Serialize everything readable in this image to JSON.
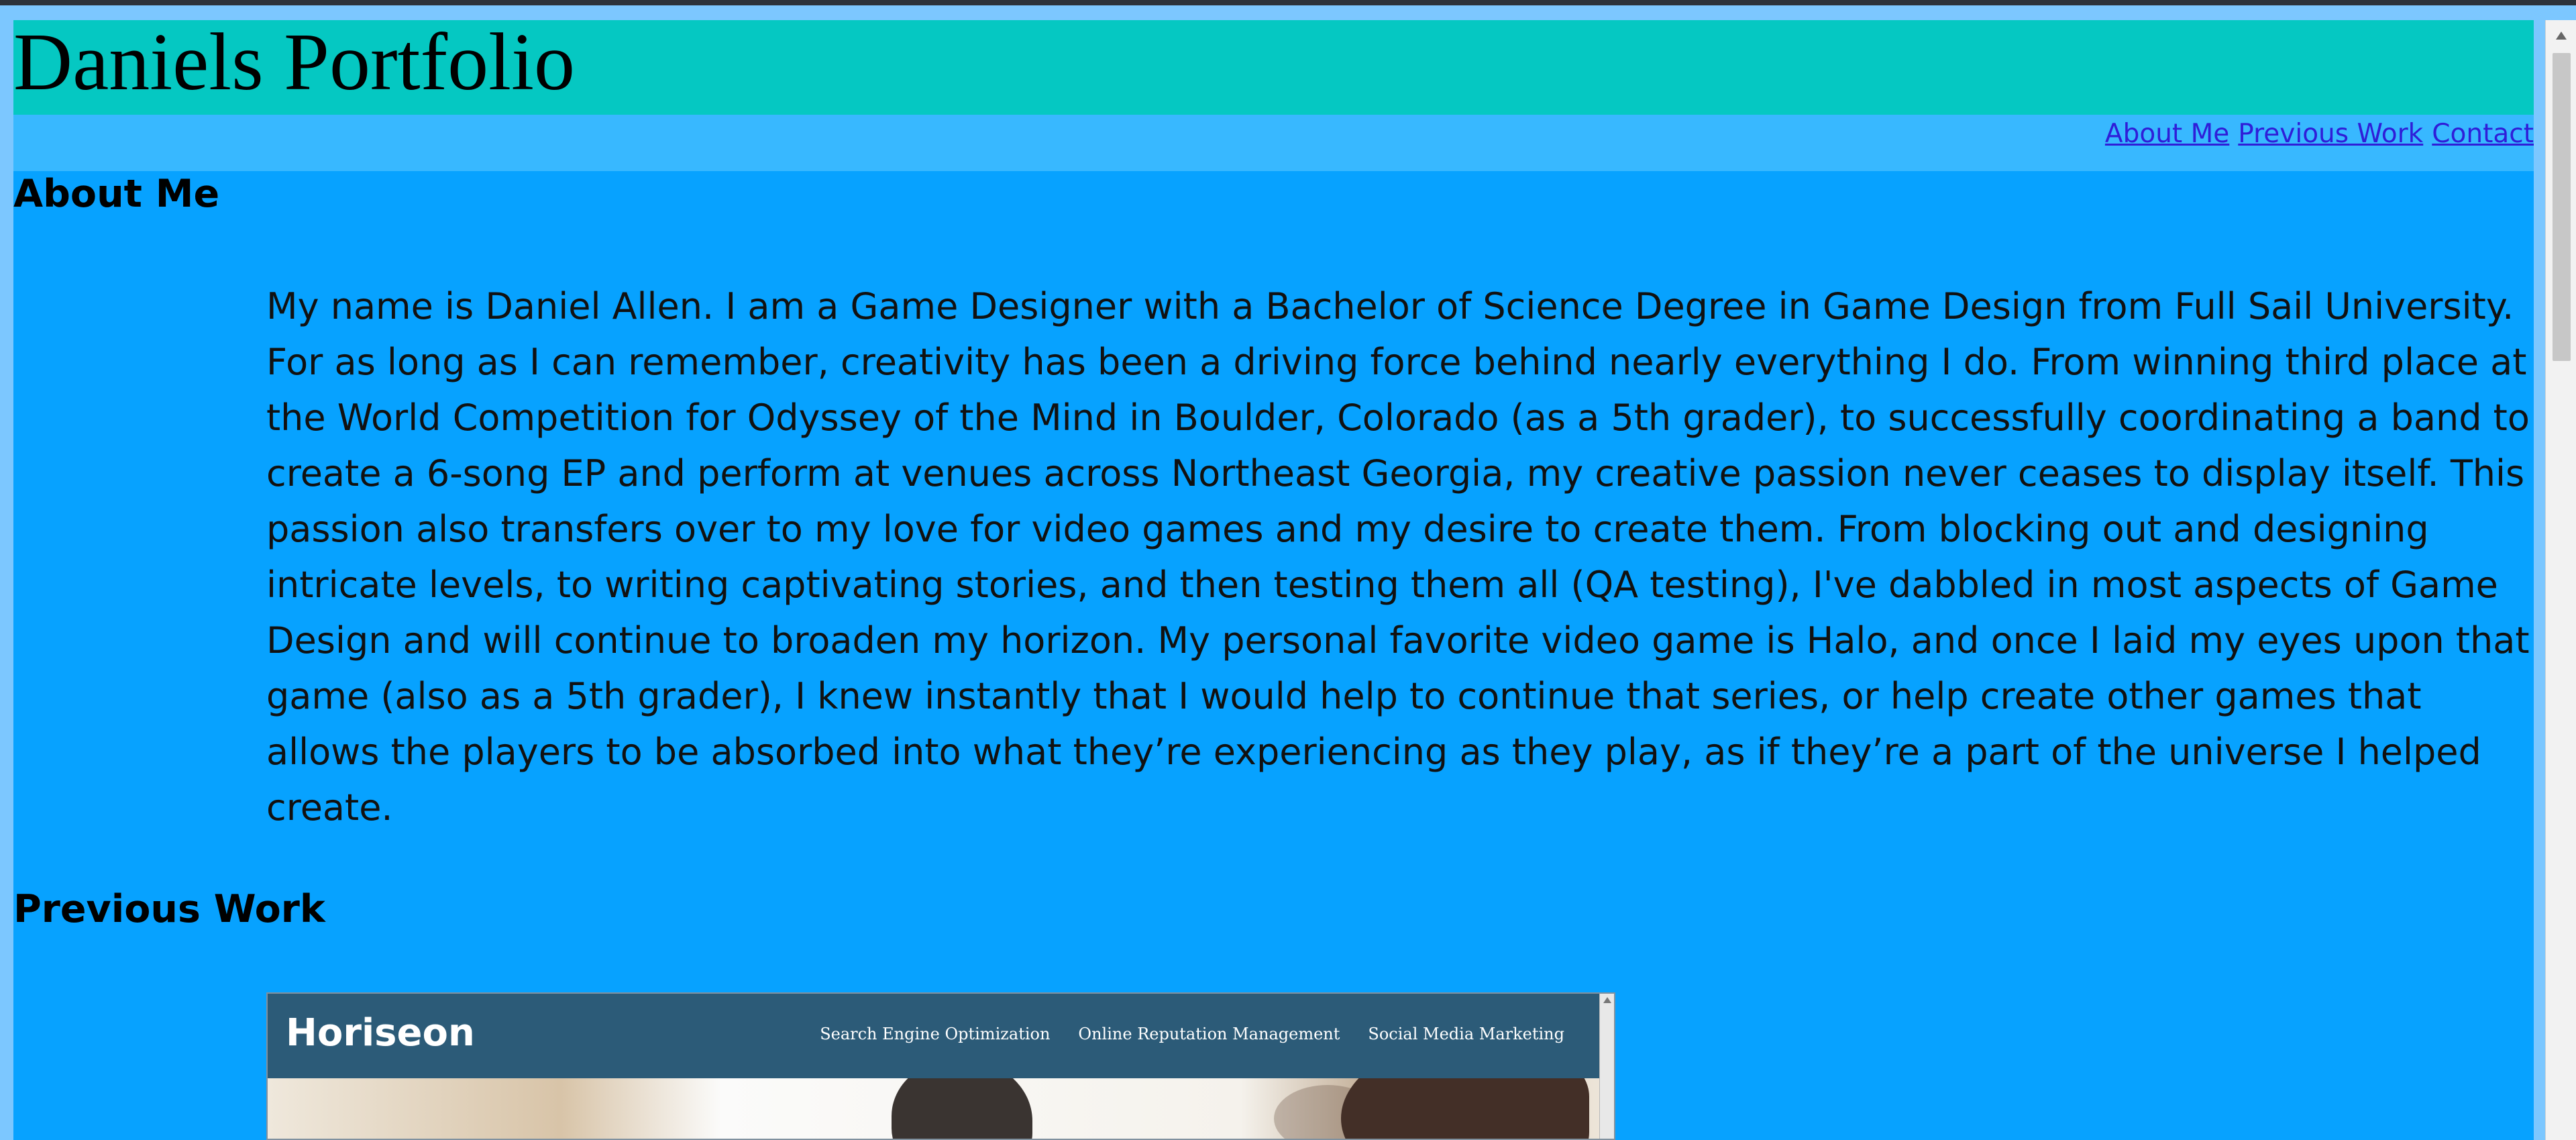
{
  "header": {
    "title": "Daniels Portfolio"
  },
  "nav": {
    "links": [
      "About Me",
      "Previous Work",
      "Contact"
    ]
  },
  "sections": {
    "about": {
      "heading": "About Me",
      "body": "My name is Daniel Allen. I am a Game Designer with a Bachelor of Science Degree in Game Design from Full Sail University. For as long as I can remember, creativity has been a driving force behind nearly everything I do. From winning third place at the World Competition for Odyssey of the Mind in Boulder, Colorado (as a 5th grader), to successfully coordinating a band to create a 6-song EP and perform at venues across Northeast Georgia, my creative passion never ceases to display itself. This passion also transfers over to my love for video games and my desire to create them. From blocking out and designing intricate levels, to writing captivating stories, and then testing them all (QA testing), I've dabbled in most aspects of Game Design and will continue to broaden my horizon. My personal favorite video game is Halo, and once I laid my eyes upon that game (also as a 5th grader), I knew instantly that I would help to continue that series, or help create other games that allows the players to be absorbed into what they’re experiencing as they play, as if they’re a part of the universe I helped create."
    },
    "previous_work": {
      "heading": "Previous Work",
      "project": {
        "logo": "Horiseon",
        "nav_items": [
          "Search Engine Optimization",
          "Online Reputation Management",
          "Social Media Marketing"
        ]
      }
    }
  },
  "colors": {
    "page_background": "#07a2ff",
    "header_background": "#05c8c2",
    "nav_background": "#38b8ff",
    "link": "#2f1ed8",
    "project_header": "#2c5b78"
  },
  "icons": {
    "window_scrollbar": "chevron-up-icon",
    "preview_scrollbar": "chevron-up-icon"
  }
}
